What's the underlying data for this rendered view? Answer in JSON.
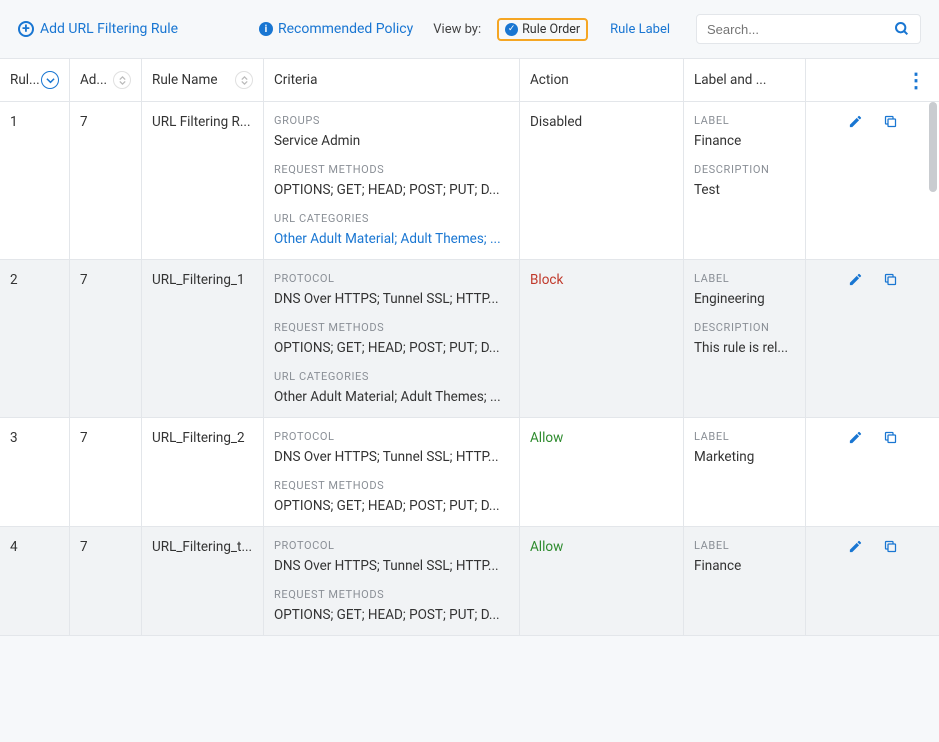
{
  "toolbar": {
    "add_label": "Add URL Filtering Rule",
    "recommended_label": "Recommended Policy",
    "view_by_label": "View by:",
    "rule_order_label": "Rule Order",
    "rule_label_label": "Rule Label",
    "search_placeholder": "Search..."
  },
  "columns": {
    "rule": "Rul...",
    "ad": "Ad...",
    "name": "Rule Name",
    "criteria": "Criteria",
    "action": "Action",
    "label": "Label and ..."
  },
  "section_labels": {
    "groups": "GROUPS",
    "protocol": "PROTOCOL",
    "request_methods": "REQUEST METHODS",
    "url_categories": "URL CATEGORIES",
    "label": "LABEL",
    "description": "DESCRIPTION"
  },
  "rows": [
    {
      "rule": "1",
      "ad": "7",
      "name": "URL Filtering R...",
      "criteria": [
        {
          "label_key": "groups",
          "value": "Service Admin",
          "link": false
        },
        {
          "label_key": "request_methods",
          "value": "OPTIONS; GET; HEAD; POST; PUT; D...",
          "link": false
        },
        {
          "label_key": "url_categories",
          "value": "Other Adult Material; Adult Themes; ...",
          "link": true
        }
      ],
      "action": "Disabled",
      "action_class": "action-disabled",
      "label_blocks": [
        {
          "label_key": "label",
          "value": "Finance"
        },
        {
          "label_key": "description",
          "value": "Test"
        }
      ]
    },
    {
      "rule": "2",
      "ad": "7",
      "name": "URL_Filtering_1",
      "criteria": [
        {
          "label_key": "protocol",
          "value": "DNS Over HTTPS; Tunnel SSL; HTTP...",
          "link": false
        },
        {
          "label_key": "request_methods",
          "value": "OPTIONS; GET; HEAD; POST; PUT; D...",
          "link": false
        },
        {
          "label_key": "url_categories",
          "value": "Other Adult Material; Adult Themes; ...",
          "link": false
        }
      ],
      "action": "Block",
      "action_class": "action-block",
      "label_blocks": [
        {
          "label_key": "label",
          "value": "Engineering"
        },
        {
          "label_key": "description",
          "value": "This rule is rel..."
        }
      ]
    },
    {
      "rule": "3",
      "ad": "7",
      "name": "URL_Filtering_2",
      "criteria": [
        {
          "label_key": "protocol",
          "value": "DNS Over HTTPS; Tunnel SSL; HTTP...",
          "link": false
        },
        {
          "label_key": "request_methods",
          "value": "OPTIONS; GET; HEAD; POST; PUT; D...",
          "link": false
        }
      ],
      "action": "Allow",
      "action_class": "action-allow",
      "label_blocks": [
        {
          "label_key": "label",
          "value": "Marketing"
        }
      ]
    },
    {
      "rule": "4",
      "ad": "7",
      "name": "URL_Filtering_t...",
      "criteria": [
        {
          "label_key": "protocol",
          "value": "DNS Over HTTPS; Tunnel SSL; HTTP...",
          "link": false
        },
        {
          "label_key": "request_methods",
          "value": "OPTIONS; GET; HEAD; POST; PUT; D...",
          "link": false
        }
      ],
      "action": "Allow",
      "action_class": "action-allow",
      "label_blocks": [
        {
          "label_key": "label",
          "value": "Finance"
        }
      ]
    }
  ]
}
